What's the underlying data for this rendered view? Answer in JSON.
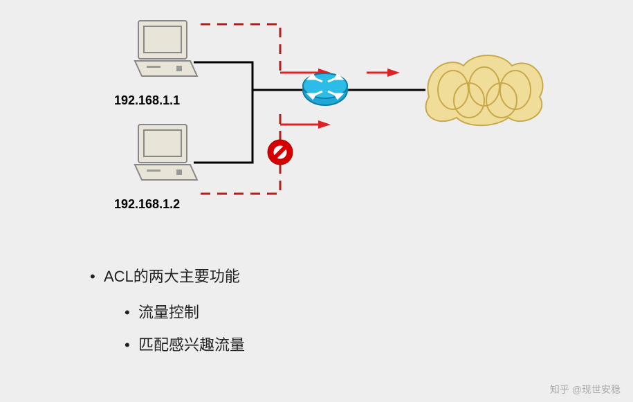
{
  "diagram": {
    "host1_ip": "192.168.1.1",
    "host2_ip": "192.168.1.2",
    "icons": {
      "computer1": "computer-icon",
      "computer2": "computer-icon",
      "router": "router-icon",
      "cloud": "cloud-icon",
      "deny": "no-entry-icon"
    },
    "flows": {
      "top_allowed": true,
      "bottom_blocked": true
    }
  },
  "text": {
    "heading": "ACL的两大主要功能",
    "sub1": "流量控制",
    "sub2": "匹配感兴趣流量"
  },
  "watermark": "知乎 @现世安稳"
}
